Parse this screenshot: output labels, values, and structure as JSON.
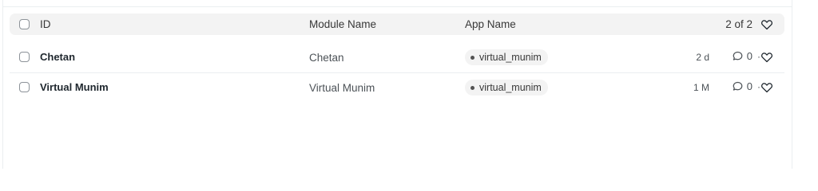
{
  "list": {
    "header": {
      "id_label": "ID",
      "module_label": "Module Name",
      "app_label": "App Name",
      "count_text": "2 of 2"
    },
    "rows": [
      {
        "id": "Chetan",
        "module_name": "Chetan",
        "app_name": "virtual_munim",
        "modified": "2 d",
        "comment_count": "0"
      },
      {
        "id": "Virtual Munim",
        "module_name": "Virtual Munim",
        "app_name": "virtual_munim",
        "modified": "1 M",
        "comment_count": "0"
      }
    ],
    "separator": "·"
  },
  "icons": {
    "checkbox": "checkbox-icon",
    "like": "heart-icon",
    "comment": "comment-icon",
    "pill_dot": "dot-icon"
  }
}
